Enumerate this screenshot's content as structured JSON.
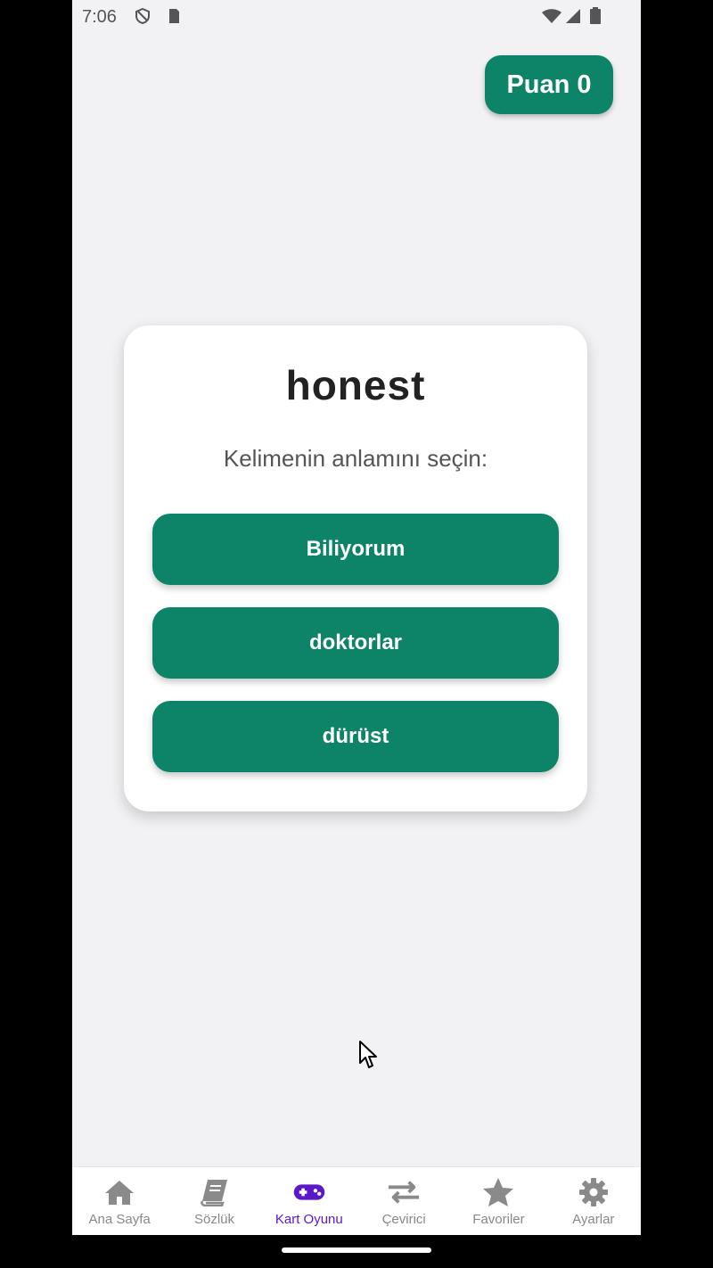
{
  "status_bar": {
    "time": "7:06"
  },
  "score": {
    "label": "Puan 0"
  },
  "card": {
    "word": "honest",
    "prompt": "Kelimenin anlamını seçin:",
    "options": [
      "Biliyorum",
      "doktorlar",
      "dürüst"
    ]
  },
  "nav": {
    "items": [
      {
        "label": "Ana Sayfa",
        "icon": "home-icon"
      },
      {
        "label": "Sözlük",
        "icon": "book-icon"
      },
      {
        "label": "Kart Oyunu",
        "icon": "gamepad-icon"
      },
      {
        "label": "Çevirici",
        "icon": "swap-arrows-icon"
      },
      {
        "label": "Favoriler",
        "icon": "star-icon"
      },
      {
        "label": "Ayarlar",
        "icon": "gear-icon"
      }
    ],
    "active": "Kart Oyunu"
  },
  "colors": {
    "primary": "#0d8367",
    "active_nav": "#5b18c9",
    "background": "#f2f2f4"
  }
}
